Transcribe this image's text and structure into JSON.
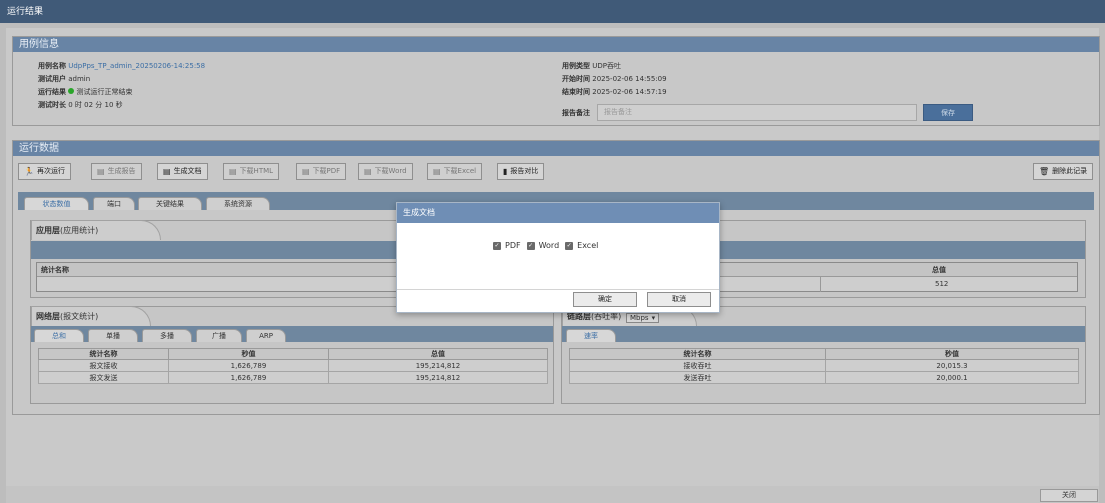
{
  "window_title": "运行结果",
  "case_info": {
    "header": "用例信息",
    "name_label": "用例名称",
    "name_value": "UdpPps_TP_admin_20250206-14:25:58",
    "user_label": "测试用户",
    "user_value": "admin",
    "result_label": "运行结果",
    "result_value": "测试运行正常结束",
    "duration_label": "测试时长",
    "duration_value": "0 时 02 分 10 秒",
    "type_label": "用例类型",
    "type_value": "UDP吞吐",
    "start_label": "开始时间",
    "start_value": "2025-02-06 14:55:09",
    "end_label": "结束时间",
    "end_value": "2025-02-06 14:57:19",
    "remark_label": "报告备注",
    "remark_placeholder": "报告备注",
    "save_label": "保存"
  },
  "run_data": {
    "header": "运行数据",
    "toolbar": {
      "rerun": "再次运行",
      "gen_report": "生成报告",
      "gen_doc": "生成文档",
      "dl_html": "下载HTML",
      "dl_pdf": "下载PDF",
      "dl_word": "下载Word",
      "dl_excel": "下载Excel",
      "compare": "报告对比",
      "delete": "删除此记录"
    },
    "tabs": [
      "状态数值",
      "端口",
      "关键结果",
      "系统资源"
    ],
    "app_layer": {
      "title": "应用层",
      "subtitle": "(应用统计)",
      "col_name": "统计名称",
      "col_total": "总值",
      "total_value": "512"
    },
    "network_layer": {
      "title": "网络层",
      "subtitle": "(报文统计)",
      "tabs": [
        "总和",
        "单播",
        "多播",
        "广播",
        "ARP"
      ],
      "columns": [
        "统计名称",
        "秒值",
        "总值"
      ],
      "rows": [
        [
          "报文接收",
          "1,626,789",
          "195,214,812"
        ],
        [
          "报文发送",
          "1,626,789",
          "195,214,812"
        ]
      ]
    },
    "link_layer": {
      "title": "链路层",
      "subtitle": "(吞吐率)",
      "unit": "Mbps",
      "tabs": [
        "速率"
      ],
      "columns": [
        "统计名称",
        "秒值"
      ],
      "rows": [
        [
          "接收吞吐",
          "20,015.3"
        ],
        [
          "发送吞吐",
          "20,000.1"
        ]
      ]
    }
  },
  "dialog": {
    "title": "生成文档",
    "options": [
      "PDF",
      "Word",
      "Excel"
    ],
    "ok": "确定",
    "cancel": "取消"
  },
  "footer": {
    "close": "关闭"
  },
  "colors": {
    "titlebar": "#405a78",
    "panel_header": "#6884a5",
    "dialog_header": "#6f8eb5",
    "status_ok": "#2aa52a"
  }
}
